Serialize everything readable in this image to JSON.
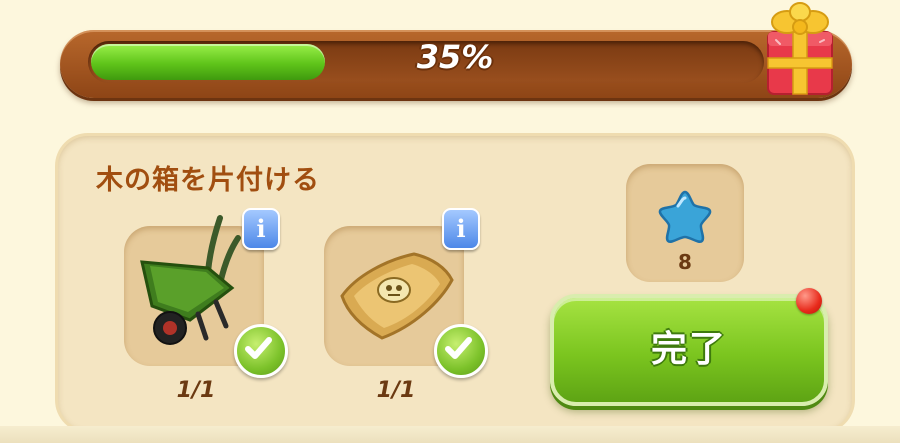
{
  "progress": {
    "percent_label": "35%",
    "value": 0.35
  },
  "quest": {
    "title": "木の箱を片付ける",
    "items": [
      {
        "icon": "wheelbarrow-icon",
        "count": "1/1",
        "completed": true,
        "info_label": "i"
      },
      {
        "icon": "sandbag-icon",
        "count": "1/1",
        "completed": true,
        "info_label": "i"
      }
    ],
    "reward": {
      "icon": "blue-star-icon",
      "count": "8"
    },
    "complete_button_label": "完了"
  },
  "colors": {
    "progress_fill": "#5fc41a",
    "frame_brown": "#8e4516",
    "title_brown": "#a14e10",
    "button_green": "#7bc51f",
    "notification_red": "#e82b1c",
    "star_blue": "#3aa4d8"
  }
}
